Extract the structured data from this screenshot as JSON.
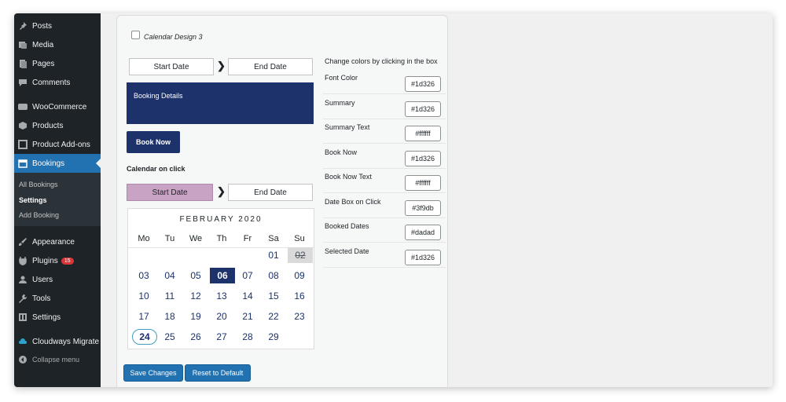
{
  "sidebar": {
    "items": [
      {
        "label": "Posts",
        "icon": "pin-icon"
      },
      {
        "label": "Media",
        "icon": "media-icon"
      },
      {
        "label": "Pages",
        "icon": "pages-icon"
      },
      {
        "label": "Comments",
        "icon": "comment-icon"
      },
      {
        "label": "WooCommerce",
        "icon": "woocommerce-icon"
      },
      {
        "label": "Products",
        "icon": "products-icon"
      },
      {
        "label": "Product Add-ons",
        "icon": "addons-icon"
      },
      {
        "label": "Bookings",
        "icon": "calendar-icon"
      },
      {
        "label": "Appearance",
        "icon": "brush-icon"
      },
      {
        "label": "Plugins",
        "icon": "plug-icon",
        "badge": "15"
      },
      {
        "label": "Users",
        "icon": "user-icon"
      },
      {
        "label": "Tools",
        "icon": "wrench-icon"
      },
      {
        "label": "Settings",
        "icon": "settings-icon"
      },
      {
        "label": "Cloudways Migrate",
        "icon": "cloud-icon"
      },
      {
        "label": "Collapse menu",
        "icon": "collapse-icon"
      }
    ],
    "submenu": [
      "All Bookings",
      "Settings",
      "Add Booking"
    ],
    "active_color": "#2271b1"
  },
  "settings": {
    "design_checkbox_label": "Calendar Design 3",
    "start_date_label": "Start Date",
    "end_date_label": "End Date",
    "booking_details_label": "Booking Details",
    "book_now_label": "Book Now",
    "calendar_on_click_label": "Calendar on click",
    "calendar": {
      "month_label": "FEBRUARY 2020",
      "weekdays": [
        "Mo",
        "Tu",
        "We",
        "Th",
        "Fr",
        "Sa",
        "Su"
      ],
      "weeks": [
        [
          "",
          "",
          "",
          "",
          "",
          "01",
          "02"
        ],
        [
          "03",
          "04",
          "05",
          "06",
          "07",
          "08",
          "09"
        ],
        [
          "10",
          "11",
          "12",
          "13",
          "14",
          "15",
          "16"
        ],
        [
          "17",
          "18",
          "19",
          "20",
          "21",
          "22",
          "23"
        ],
        [
          "24",
          "25",
          "26",
          "27",
          "28",
          "29",
          ""
        ]
      ],
      "booked_day": "02",
      "selected_day": "06",
      "today_day": "24"
    },
    "colors_heading": "Change colors by clicking in the box",
    "color_options": [
      {
        "label": "Font Color",
        "value": "#1d326"
      },
      {
        "label": "Summary",
        "value": "#1d326"
      },
      {
        "label": "Summary Text",
        "value": "#ffffff"
      },
      {
        "label": "Book Now",
        "value": "#1d326"
      },
      {
        "label": "Book Now Text",
        "value": "#ffffff"
      },
      {
        "label": "Date Box on Click",
        "value": "#3f9db"
      },
      {
        "label": "Booked Dates",
        "value": "#dadad"
      },
      {
        "label": "Selected Date",
        "value": "#1d326"
      }
    ],
    "save_button_label": "Save Changes",
    "reset_button_label": "Reset to Default",
    "theme_colors": {
      "navy": "#1d326a",
      "pink": "#c9a3c4",
      "booked": "#dadada"
    }
  }
}
